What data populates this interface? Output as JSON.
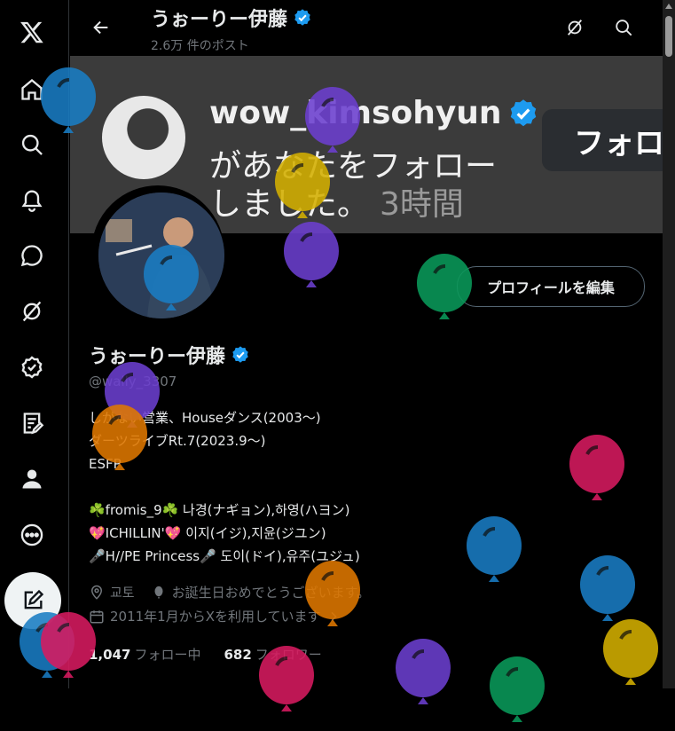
{
  "header": {
    "display_name": "うぉーりー伊藤",
    "post_count": "2.6万 件のポスト"
  },
  "banner": {
    "username": "wow_kimsohyun",
    "line2": "があなたをフォロー",
    "line3": "しました。",
    "time": "3時間",
    "follow_label": "フォロ"
  },
  "profile": {
    "edit_label": "プロフィールを編集",
    "display_name": "うぉーりー伊藤",
    "handle": "@wally_3307",
    "bio": [
      "しがない営業、Houseダンス(2003〜)",
      "ダーツライブRt.7(2023.9〜)",
      "ESFP",
      "",
      "☘️fromis_9☘️ 나경(ナギョン),하영(ハヨン)",
      "💖ICHILLIN'💖 이지(イジ),지윤(ジユン)",
      "🎤H//PE Princess🎤 도이(ドイ),유주(ユジュ)"
    ],
    "location": "교토",
    "birthday": "お誕生日おめでとうございます。",
    "joined": "2011年1月からXを利用しています",
    "following_count": "1,047",
    "following_label": "フォロー中",
    "followers_count": "682",
    "followers_label": "フォロワー"
  },
  "colors": {
    "background": "#000000",
    "banner": "#3b3b3b",
    "verified": "#1d9bf0",
    "text_secondary": "#71767b"
  },
  "icons": [
    "x-logo-icon",
    "home-icon",
    "search-icon",
    "bell-icon",
    "messages-icon",
    "grok-icon",
    "verified-icon",
    "lists-icon",
    "profile-icon",
    "more-icon",
    "compose-icon",
    "back-icon",
    "grok-icon",
    "search-icon",
    "location-icon",
    "balloon-icon",
    "calendar-icon",
    "chevron-right-icon"
  ],
  "balloons": [
    {
      "color": "#1a7dc4"
    },
    {
      "color": "#6c3fd0"
    },
    {
      "color": "#d4b000"
    },
    {
      "color": "#6c3fd0"
    },
    {
      "color": "#1a7dc4"
    },
    {
      "color": "#0a9a5a"
    },
    {
      "color": "#6c3fd0"
    },
    {
      "color": "#e07800"
    },
    {
      "color": "#d81b60"
    },
    {
      "color": "#1a7dc4"
    },
    {
      "color": "#1a7dc4"
    },
    {
      "color": "#e07800"
    },
    {
      "color": "#1a7dc4"
    },
    {
      "color": "#d4b000"
    },
    {
      "color": "#d81b60"
    },
    {
      "color": "#d81b60"
    },
    {
      "color": "#6c3fd0"
    },
    {
      "color": "#0a9a5a"
    }
  ]
}
